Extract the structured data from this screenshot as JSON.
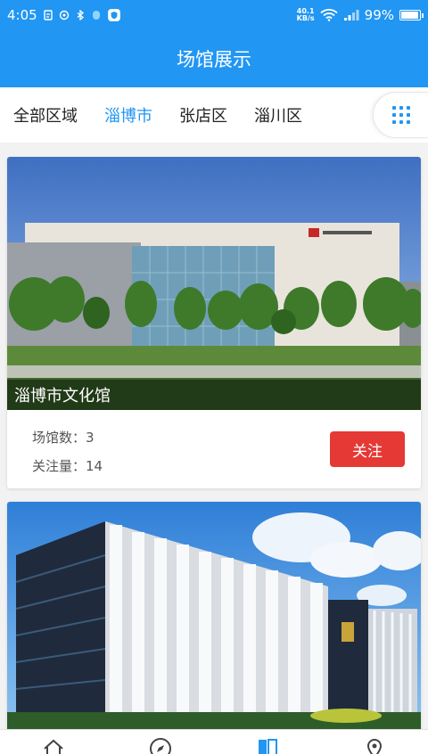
{
  "status_bar": {
    "time": "4:05",
    "net_speed_value": "40.1",
    "net_speed_unit": "KB/s",
    "battery": "99%"
  },
  "header": {
    "title": "场馆展示"
  },
  "tabs": [
    {
      "label": "全部区域",
      "active": false
    },
    {
      "label": "淄博市",
      "active": true
    },
    {
      "label": "张店区",
      "active": false
    },
    {
      "label": "淄川区",
      "active": false
    }
  ],
  "venues": [
    {
      "name": "淄博市文化馆",
      "venue_count_label": "场馆数：3",
      "follow_count_label": "关注量：14",
      "follow_label": "关注"
    }
  ],
  "colors": {
    "primary": "#2196f3",
    "follow_button": "#e53935"
  },
  "bottom_nav": [
    {
      "icon": "home-icon"
    },
    {
      "icon": "compass-icon"
    },
    {
      "icon": "book-icon",
      "active": true
    },
    {
      "icon": "location-icon"
    }
  ]
}
